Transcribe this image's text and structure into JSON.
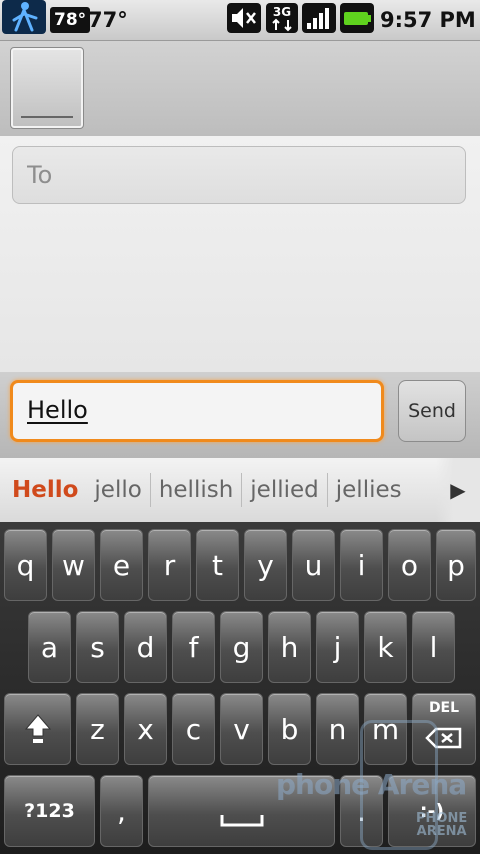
{
  "status_bar": {
    "temp_icon_text": "78°",
    "temperature": "77°",
    "network": "3G",
    "time": "9:57 PM",
    "icons": [
      "aim-icon",
      "mute-icon",
      "3g-icon",
      "signal-icon",
      "battery-icon"
    ]
  },
  "compose": {
    "to_placeholder": "To"
  },
  "message": {
    "text": "Hello",
    "send_label": "Send"
  },
  "suggestions": [
    "Hello",
    "jello",
    "hellish",
    "jellied",
    "jellies"
  ],
  "keyboard": {
    "row1": [
      "q",
      "w",
      "e",
      "r",
      "t",
      "y",
      "u",
      "i",
      "o",
      "p"
    ],
    "row2": [
      "a",
      "s",
      "d",
      "f",
      "g",
      "h",
      "j",
      "k",
      "l"
    ],
    "row3": [
      "z",
      "x",
      "c",
      "v",
      "b",
      "n",
      "m"
    ],
    "del_label": "DEL",
    "symbols_label": "?123",
    "comma_label": ",",
    "period_label": ".",
    "smiley_label": ":-)"
  },
  "watermark": {
    "text": "phone Arena",
    "logo_text_1": "PHONE",
    "logo_text_2": "ARENA"
  },
  "colors": {
    "accent_orange": "#f08a1c",
    "suggestion_highlight": "#d04a1c",
    "battery_green": "#5fd21e"
  }
}
